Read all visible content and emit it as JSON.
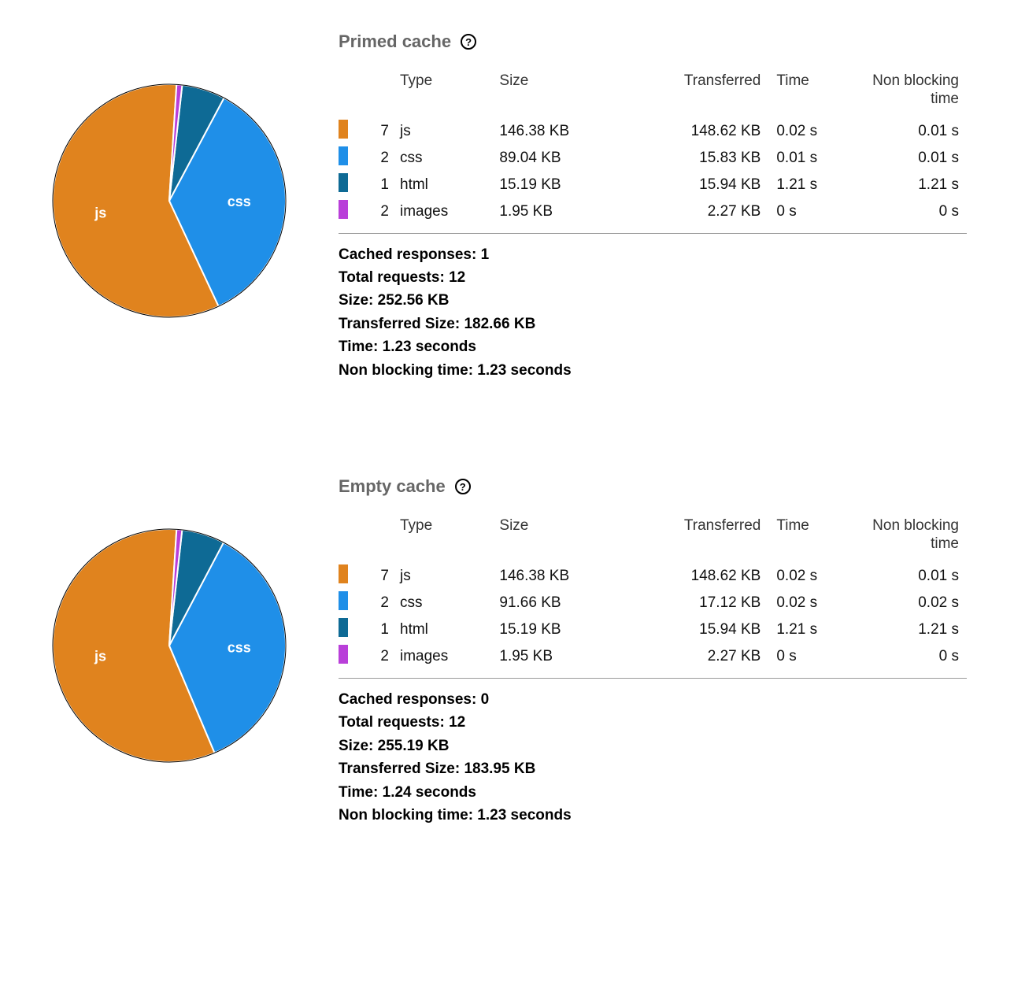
{
  "colors": {
    "js": "#E0831E",
    "css": "#1F8FE8",
    "html": "#0E6A95",
    "images": "#B93FD9"
  },
  "table_headers": {
    "count": "",
    "type": "Type",
    "size": "Size",
    "transferred": "Transferred",
    "time": "Time",
    "non_blocking": "Non blocking time"
  },
  "summary_labels": {
    "cached": "Cached responses",
    "total": "Total requests",
    "size": "Size",
    "transferred": "Transferred Size",
    "time": "Time",
    "nbt": "Non blocking time"
  },
  "sections": [
    {
      "title": "Primed cache",
      "chart_slices": [
        {
          "key": "js",
          "label": "js",
          "size_kb": 146.38
        },
        {
          "key": "css",
          "label": "css",
          "size_kb": 89.04
        },
        {
          "key": "html",
          "label": "",
          "size_kb": 15.19
        },
        {
          "key": "images",
          "label": "",
          "size_kb": 1.95
        }
      ],
      "rows": [
        {
          "color": "js",
          "count": 7,
          "type": "js",
          "size": "146.38 KB",
          "transferred": "148.62 KB",
          "time": "0.02 s",
          "nbt": "0.01 s"
        },
        {
          "color": "css",
          "count": 2,
          "type": "css",
          "size": "89.04 KB",
          "transferred": "15.83 KB",
          "time": "0.01 s",
          "nbt": "0.01 s"
        },
        {
          "color": "html",
          "count": 1,
          "type": "html",
          "size": "15.19 KB",
          "transferred": "15.94 KB",
          "time": "1.21 s",
          "nbt": "1.21 s"
        },
        {
          "color": "images",
          "count": 2,
          "type": "images",
          "size": "1.95 KB",
          "transferred": "2.27 KB",
          "time": "0 s",
          "nbt": "0 s"
        }
      ],
      "summary": {
        "cached": "1",
        "total": "12",
        "size": "252.56 KB",
        "transferred": "182.66 KB",
        "time": "1.23 seconds",
        "nbt": "1.23 seconds"
      }
    },
    {
      "title": "Empty cache",
      "chart_slices": [
        {
          "key": "js",
          "label": "js",
          "size_kb": 146.38
        },
        {
          "key": "css",
          "label": "css",
          "size_kb": 91.66
        },
        {
          "key": "html",
          "label": "",
          "size_kb": 15.19
        },
        {
          "key": "images",
          "label": "",
          "size_kb": 1.95
        }
      ],
      "rows": [
        {
          "color": "js",
          "count": 7,
          "type": "js",
          "size": "146.38 KB",
          "transferred": "148.62 KB",
          "time": "0.02 s",
          "nbt": "0.01 s"
        },
        {
          "color": "css",
          "count": 2,
          "type": "css",
          "size": "91.66 KB",
          "transferred": "17.12 KB",
          "time": "0.02 s",
          "nbt": "0.02 s"
        },
        {
          "color": "html",
          "count": 1,
          "type": "html",
          "size": "15.19 KB",
          "transferred": "15.94 KB",
          "time": "1.21 s",
          "nbt": "1.21 s"
        },
        {
          "color": "images",
          "count": 2,
          "type": "images",
          "size": "1.95 KB",
          "transferred": "2.27 KB",
          "time": "0 s",
          "nbt": "0 s"
        }
      ],
      "summary": {
        "cached": "0",
        "total": "12",
        "size": "255.19 KB",
        "transferred": "183.95 KB",
        "time": "1.24 seconds",
        "nbt": "1.23 seconds"
      }
    }
  ],
  "chart_data": [
    {
      "type": "pie",
      "title": "Primed cache — resource size breakdown",
      "categories": [
        "js",
        "css",
        "html",
        "images"
      ],
      "values": [
        146.38,
        89.04,
        15.19,
        1.95
      ],
      "unit": "KB"
    },
    {
      "type": "pie",
      "title": "Empty cache — resource size breakdown",
      "categories": [
        "js",
        "css",
        "html",
        "images"
      ],
      "values": [
        146.38,
        91.66,
        15.19,
        1.95
      ],
      "unit": "KB"
    }
  ]
}
